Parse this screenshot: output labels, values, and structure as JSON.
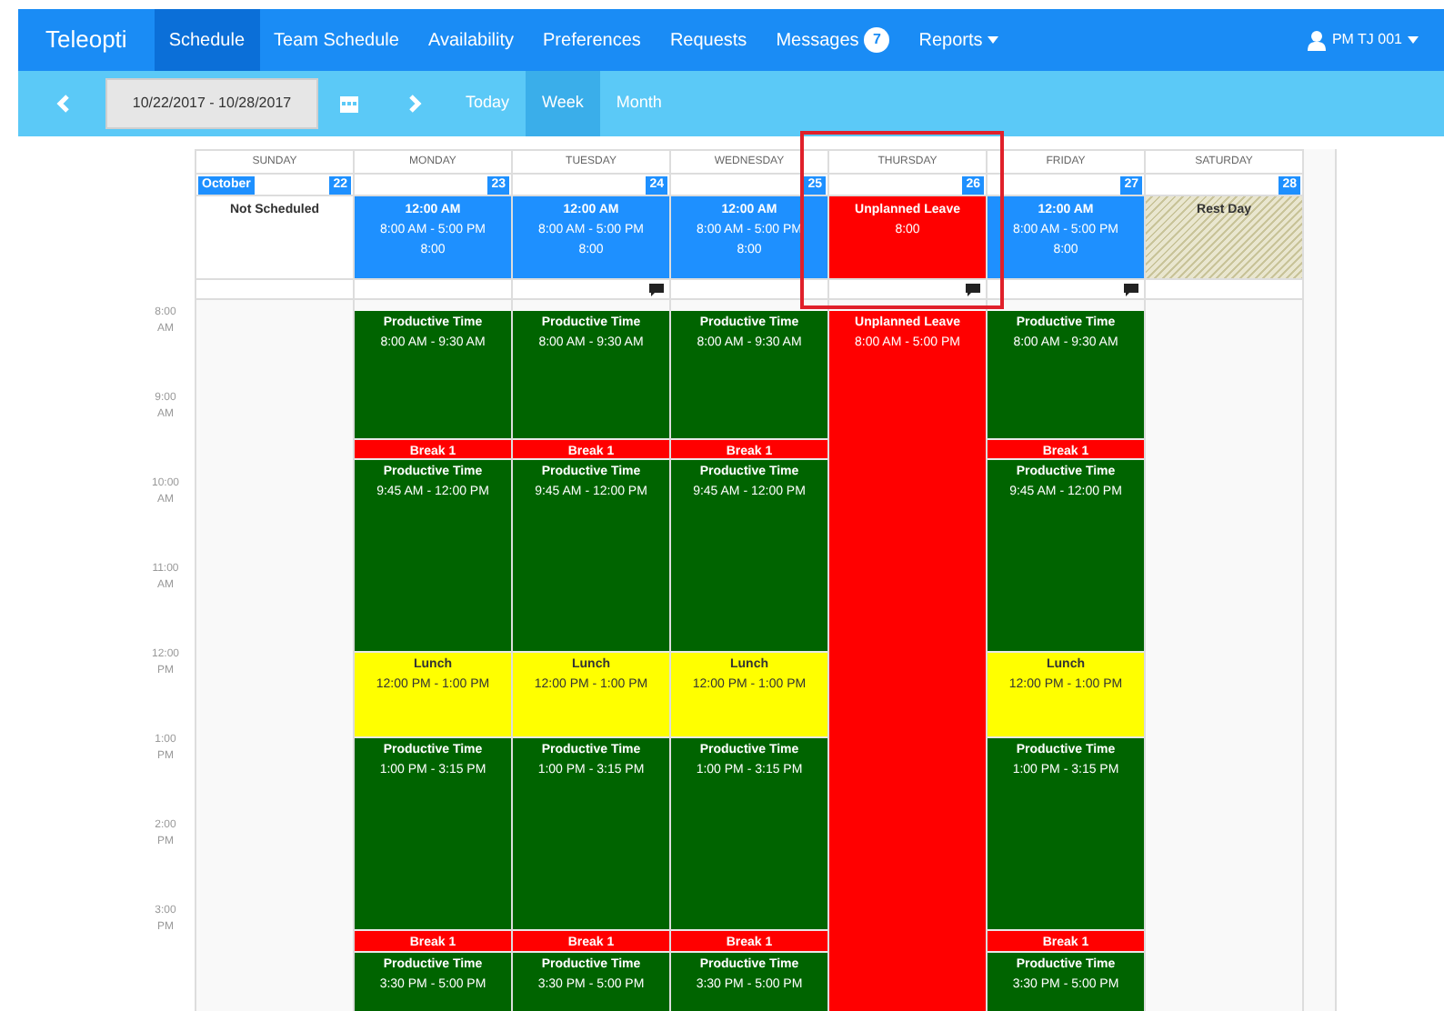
{
  "navbar": {
    "brand": "Teleopti",
    "items": [
      {
        "label": "Schedule",
        "selected": true
      },
      {
        "label": "Team Schedule",
        "selected": false
      },
      {
        "label": "Availability",
        "selected": false
      },
      {
        "label": "Preferences",
        "selected": false
      },
      {
        "label": "Requests",
        "selected": false
      },
      {
        "label": "Messages",
        "selected": false,
        "badge": "7"
      },
      {
        "label": "Reports",
        "selected": false,
        "dropdown": true
      }
    ],
    "user": "PM TJ 001"
  },
  "toolbar": {
    "date_range": "10/22/2017 - 10/28/2017",
    "views": [
      {
        "label": "Today",
        "selected": false
      },
      {
        "label": "Week",
        "selected": true
      },
      {
        "label": "Month",
        "selected": false
      }
    ]
  },
  "time_labels": [
    [
      "8:00",
      "AM"
    ],
    [
      "9:00",
      "AM"
    ],
    [
      "10:00",
      "AM"
    ],
    [
      "11:00",
      "AM"
    ],
    [
      "12:00",
      "PM"
    ],
    [
      "1:00",
      "PM"
    ],
    [
      "2:00",
      "PM"
    ],
    [
      "3:00",
      "PM"
    ]
  ],
  "days": [
    {
      "name": "SUNDAY",
      "month": "October",
      "date": "22",
      "summary": {
        "kind": "none",
        "lines": [
          "Not Scheduled"
        ]
      },
      "comment": false
    },
    {
      "name": "MONDAY",
      "date": "23",
      "summary": {
        "kind": "shift",
        "lines": [
          "12:00 AM",
          "8:00 AM - 5:00 PM",
          "8:00"
        ]
      },
      "comment": false,
      "activities": [
        {
          "kind": "work",
          "color": "#006400",
          "title": "Productive Time",
          "time": "8:00 AM - 9:30 AM"
        },
        {
          "kind": "break",
          "color": "#ff0000",
          "title": "Break 1"
        },
        {
          "kind": "work",
          "color": "#006400",
          "title": "Productive Time",
          "time": "9:45 AM - 12:00 PM"
        },
        {
          "kind": "lunch",
          "color": "#ffff00",
          "title": "Lunch",
          "time": "12:00 PM - 1:00 PM"
        },
        {
          "kind": "work",
          "color": "#006400",
          "title": "Productive Time",
          "time": "1:00 PM - 3:15 PM"
        },
        {
          "kind": "break",
          "color": "#ff0000",
          "title": "Break 1"
        },
        {
          "kind": "work",
          "color": "#006400",
          "title": "Productive Time",
          "time": "3:30 PM - 5:00 PM"
        }
      ]
    },
    {
      "name": "TUESDAY",
      "date": "24",
      "summary": {
        "kind": "shift",
        "lines": [
          "12:00 AM",
          "8:00 AM - 5:00 PM",
          "8:00"
        ]
      },
      "comment": true,
      "activities": [
        {
          "kind": "work",
          "color": "#006400",
          "title": "Productive Time",
          "time": "8:00 AM - 9:30 AM"
        },
        {
          "kind": "break",
          "color": "#ff0000",
          "title": "Break 1"
        },
        {
          "kind": "work",
          "color": "#006400",
          "title": "Productive Time",
          "time": "9:45 AM - 12:00 PM"
        },
        {
          "kind": "lunch",
          "color": "#ffff00",
          "title": "Lunch",
          "time": "12:00 PM - 1:00 PM"
        },
        {
          "kind": "work",
          "color": "#006400",
          "title": "Productive Time",
          "time": "1:00 PM - 3:15 PM"
        },
        {
          "kind": "break",
          "color": "#ff0000",
          "title": "Break 1"
        },
        {
          "kind": "work",
          "color": "#006400",
          "title": "Productive Time",
          "time": "3:30 PM - 5:00 PM"
        }
      ]
    },
    {
      "name": "WEDNESDAY",
      "date": "25",
      "summary": {
        "kind": "shift",
        "lines": [
          "12:00 AM",
          "8:00 AM - 5:00 PM",
          "8:00"
        ]
      },
      "comment": false,
      "activities": [
        {
          "kind": "work",
          "color": "#006400",
          "title": "Productive Time",
          "time": "8:00 AM - 9:30 AM"
        },
        {
          "kind": "break",
          "color": "#ff0000",
          "title": "Break 1"
        },
        {
          "kind": "work",
          "color": "#006400",
          "title": "Productive Time",
          "time": "9:45 AM - 12:00 PM"
        },
        {
          "kind": "lunch",
          "color": "#ffff00",
          "title": "Lunch",
          "time": "12:00 PM - 1:00 PM"
        },
        {
          "kind": "work",
          "color": "#006400",
          "title": "Productive Time",
          "time": "1:00 PM - 3:15 PM"
        },
        {
          "kind": "break",
          "color": "#ff0000",
          "title": "Break 1"
        },
        {
          "kind": "work",
          "color": "#006400",
          "title": "Productive Time",
          "time": "3:30 PM - 5:00 PM"
        }
      ]
    },
    {
      "name": "THURSDAY",
      "date": "26",
      "summary": {
        "kind": "leave",
        "lines": [
          "Unplanned Leave",
          "8:00"
        ]
      },
      "comment": true,
      "activities": [
        {
          "kind": "leave",
          "color": "#ff0000",
          "title": "Unplanned Leave",
          "time": "8:00 AM - 5:00 PM"
        }
      ]
    },
    {
      "name": "FRIDAY",
      "date": "27",
      "summary": {
        "kind": "shift",
        "lines": [
          "12:00 AM",
          "8:00 AM - 5:00 PM",
          "8:00"
        ]
      },
      "comment": true,
      "activities": [
        {
          "kind": "work",
          "color": "#006400",
          "title": "Productive Time",
          "time": "8:00 AM - 9:30 AM"
        },
        {
          "kind": "break",
          "color": "#ff0000",
          "title": "Break 1"
        },
        {
          "kind": "work",
          "color": "#006400",
          "title": "Productive Time",
          "time": "9:45 AM - 12:00 PM"
        },
        {
          "kind": "lunch",
          "color": "#ffff00",
          "title": "Lunch",
          "time": "12:00 PM - 1:00 PM"
        },
        {
          "kind": "work",
          "color": "#006400",
          "title": "Productive Time",
          "time": "1:00 PM - 3:15 PM"
        },
        {
          "kind": "break",
          "color": "#ff0000",
          "title": "Break 1"
        },
        {
          "kind": "work",
          "color": "#006400",
          "title": "Productive Time",
          "time": "3:30 PM - 5:00 PM"
        }
      ]
    },
    {
      "name": "SATURDAY",
      "date": "28",
      "summary": {
        "kind": "rest",
        "lines": [
          "Rest Day"
        ]
      },
      "comment": false
    }
  ]
}
